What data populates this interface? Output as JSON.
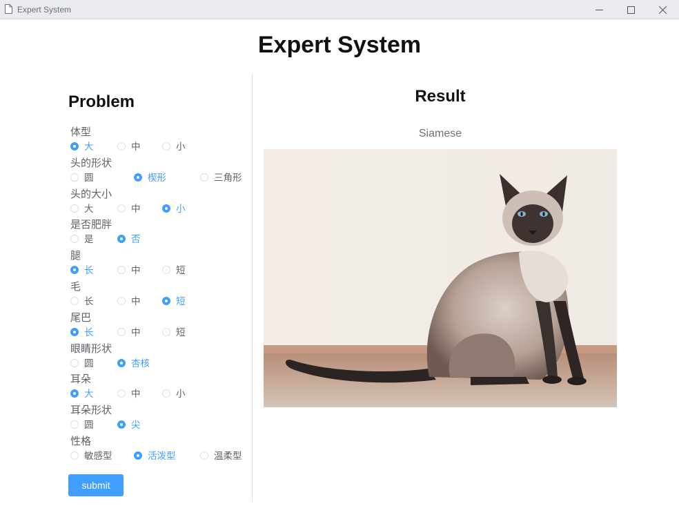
{
  "window": {
    "title": "Expert System",
    "icon": "document-icon",
    "controls": [
      "minimize-icon",
      "maximize-icon",
      "close-icon"
    ]
  },
  "app": {
    "title": "Expert System"
  },
  "problem": {
    "heading": "Problem",
    "questions": [
      {
        "label": "体型",
        "options": [
          "大",
          "中",
          "小"
        ],
        "selected": 0
      },
      {
        "label": "头的形状",
        "options": [
          "圆",
          "楔形",
          "三角形"
        ],
        "selected": 1
      },
      {
        "label": "头的大小",
        "options": [
          "大",
          "中",
          "小"
        ],
        "selected": 2
      },
      {
        "label": "是否肥胖",
        "options": [
          "是",
          "否"
        ],
        "selected": 1
      },
      {
        "label": "腿",
        "options": [
          "长",
          "中",
          "短"
        ],
        "selected": 0
      },
      {
        "label": "毛",
        "options": [
          "长",
          "中",
          "短"
        ],
        "selected": 2
      },
      {
        "label": "尾巴",
        "options": [
          "长",
          "中",
          "短"
        ],
        "selected": 0
      },
      {
        "label": "眼睛形状",
        "options": [
          "圆",
          "杏核"
        ],
        "selected": 1
      },
      {
        "label": "耳朵",
        "options": [
          "大",
          "中",
          "小"
        ],
        "selected": 0
      },
      {
        "label": "耳朵形状",
        "options": [
          "圆",
          "尖"
        ],
        "selected": 1
      },
      {
        "label": "性格",
        "options": [
          "敏感型",
          "活泼型",
          "温柔型"
        ],
        "selected": 1
      }
    ],
    "submit_label": "submit"
  },
  "result": {
    "heading": "Result",
    "label": "Siamese",
    "image": "siamese-cat-photo"
  },
  "colors": {
    "accent": "#409eff",
    "titlebar": "#e9ebee",
    "divider": "#dcdfe6"
  }
}
